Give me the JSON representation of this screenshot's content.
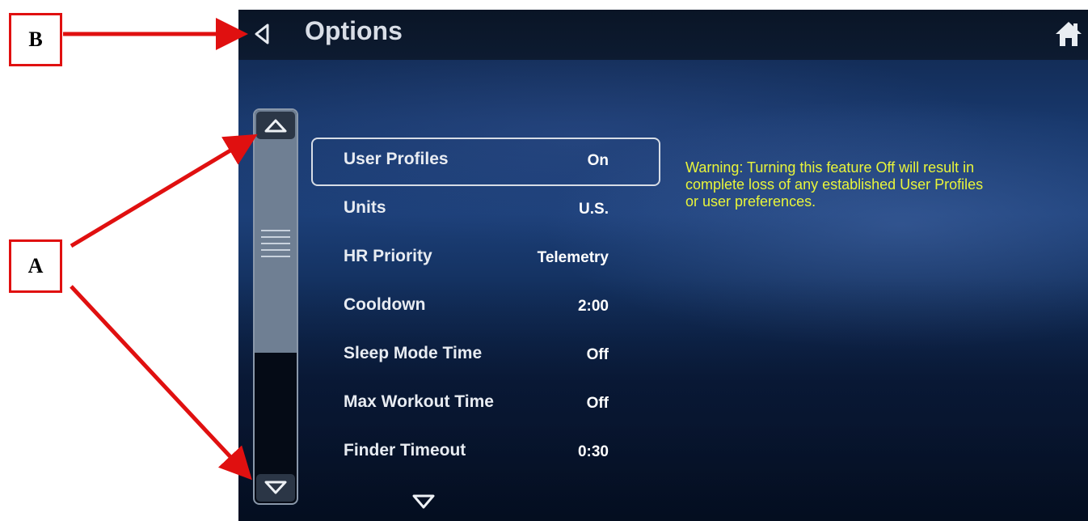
{
  "header": {
    "title": "Options",
    "back_icon": "back-triangle-icon",
    "home_icon": "home-icon"
  },
  "options": [
    {
      "label": "User Profiles",
      "value": "On",
      "selected": true
    },
    {
      "label": "Units",
      "value": "U.S."
    },
    {
      "label": "HR Priority",
      "value": "Telemetry"
    },
    {
      "label": "Cooldown",
      "value": "2:00"
    },
    {
      "label": "Sleep Mode Time",
      "value": "Off"
    },
    {
      "label": "Max Workout Time",
      "value": "Off"
    },
    {
      "label": "Finder Timeout",
      "value": "0:30"
    }
  ],
  "warning": "Warning: Turning this feature Off will result in complete loss of any established User Profiles or user preferences.",
  "callouts": {
    "a": "A",
    "b": "B"
  },
  "colors": {
    "warning_text": "#e9f53a",
    "callout_red": "#e01010",
    "topbar": "#0a1526"
  }
}
